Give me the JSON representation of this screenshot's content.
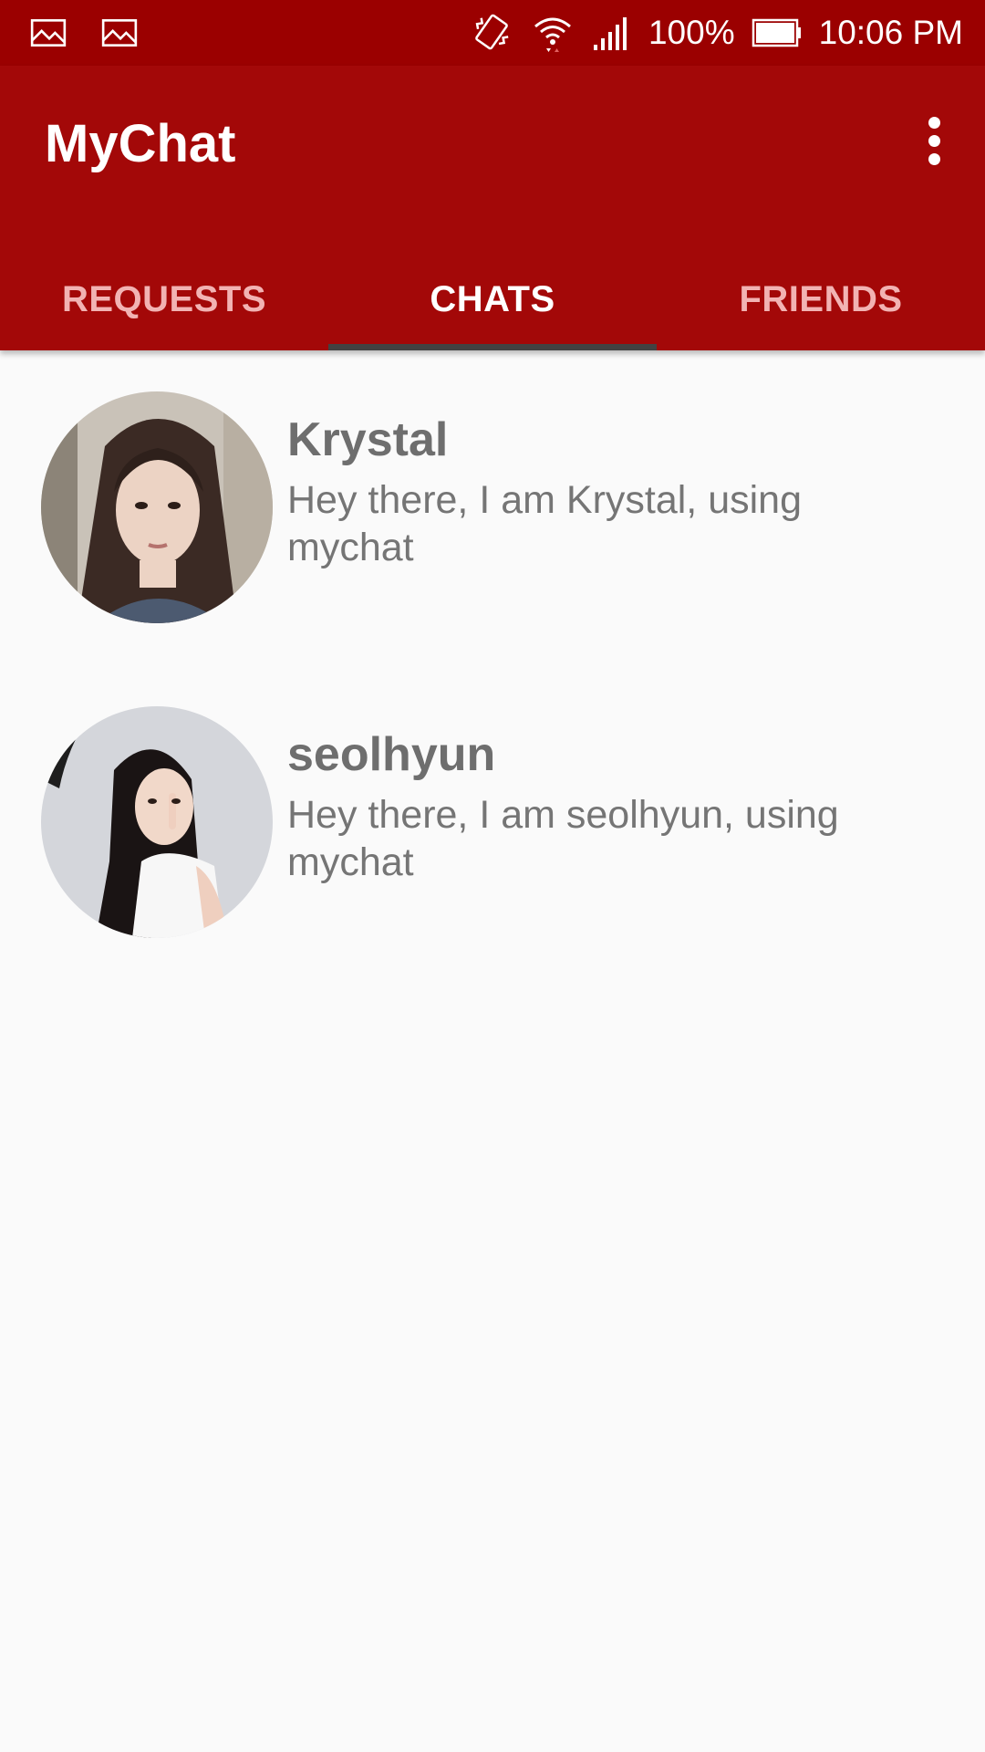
{
  "status_bar": {
    "notification_icons": [
      "image-icon",
      "image-icon"
    ],
    "right_icons": [
      "vibrate-icon",
      "wifi-icon",
      "signal-icon"
    ],
    "battery_percent": "100%",
    "time": "10:06 PM"
  },
  "app_bar": {
    "title": "MyChat",
    "overflow_icon": "more-vert-icon"
  },
  "tabs": [
    {
      "label": "REQUESTS",
      "active": false
    },
    {
      "label": "CHATS",
      "active": true
    },
    {
      "label": "FRIENDS",
      "active": false
    }
  ],
  "chats": [
    {
      "name": "Krystal",
      "status": "Hey there, I am Krystal, using mychat"
    },
    {
      "name": "seolhyun",
      "status": "Hey there, I am seolhyun, using mychat"
    }
  ],
  "colors": {
    "status_bar": "#9b0000",
    "app_bar": "#a30808",
    "tab_indicator": "#424242",
    "background": "#fafafa"
  }
}
